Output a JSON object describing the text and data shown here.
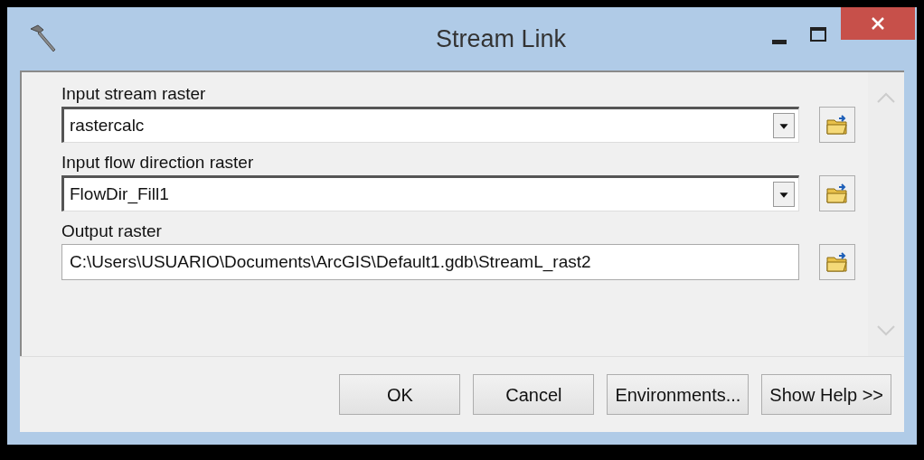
{
  "window": {
    "title": "Stream Link"
  },
  "parameters": [
    {
      "label": "Input stream raster",
      "value": "rastercalc",
      "kind": "combo"
    },
    {
      "label": "Input flow direction raster",
      "value": "FlowDir_Fill1",
      "kind": "combo"
    },
    {
      "label": "Output raster",
      "value": "C:\\Users\\USUARIO\\Documents\\ArcGIS\\Default1.gdb\\StreamL_rast2",
      "kind": "text"
    }
  ],
  "buttons": [
    "OK",
    "Cancel",
    "Environments...",
    "Show Help >>"
  ]
}
